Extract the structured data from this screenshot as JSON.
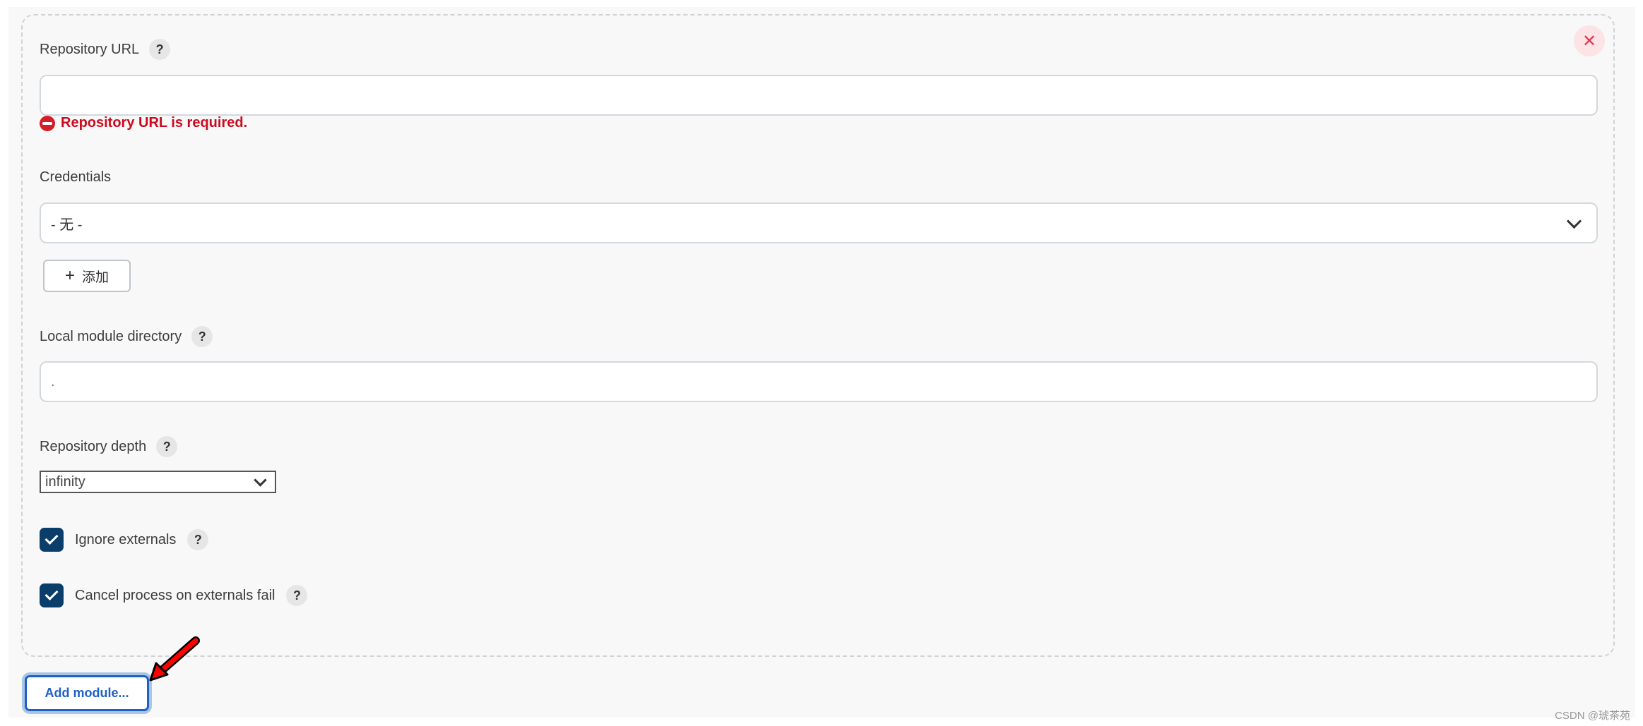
{
  "module": {
    "close_label": "✕",
    "repository_url": {
      "label": "Repository URL",
      "help": "?",
      "value": "",
      "error": "Repository URL is required."
    },
    "credentials": {
      "label": "Credentials",
      "selected": "- 无 -",
      "add_button": {
        "icon": "+",
        "label": "添加"
      }
    },
    "local_module_directory": {
      "label": "Local module directory",
      "help": "?",
      "value": "."
    },
    "repository_depth": {
      "label": "Repository depth",
      "help": "?",
      "selected": "infinity"
    },
    "ignore_externals": {
      "label": "Ignore externals",
      "checked": true,
      "help": "?"
    },
    "cancel_on_externals_fail": {
      "label": "Cancel process on externals fail",
      "checked": true,
      "help": "?"
    }
  },
  "add_module_button": "Add module...",
  "annotation": {
    "type": "red-arrow",
    "color": "#ff0000"
  },
  "watermark": "CSDN @琥茶苑",
  "colors": {
    "error": "#cc0a1f",
    "checkbox": "#0b3d6b",
    "primary": "#1f5fc8",
    "close": "#e2384e"
  }
}
